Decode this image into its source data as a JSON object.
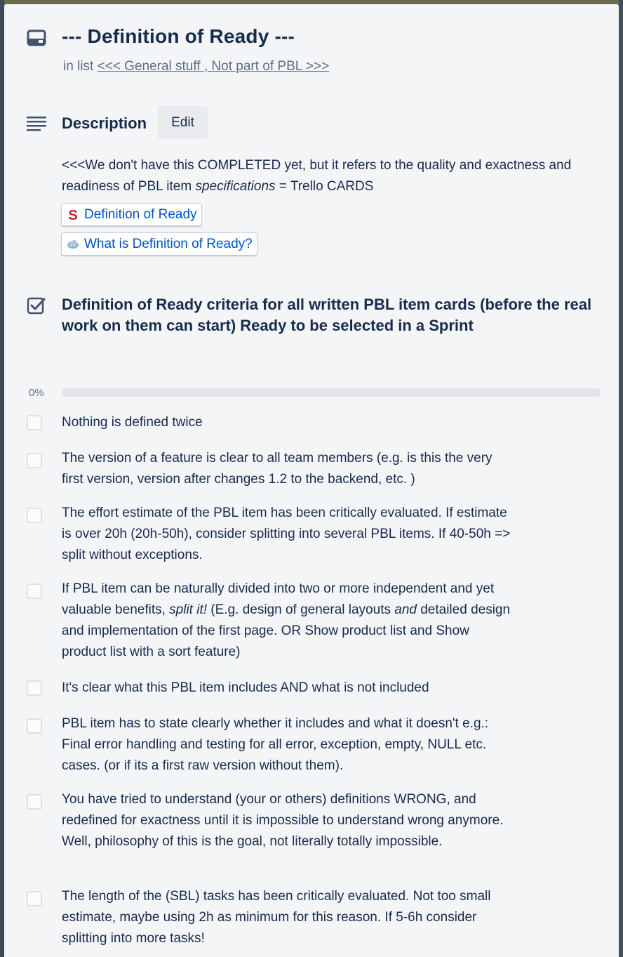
{
  "card": {
    "title": "--- Definition of Ready ---",
    "in_list_prefix": "in list",
    "list_name": "<<< General stuff , Not part of PBL >>>"
  },
  "description": {
    "heading": "Description",
    "edit_label": "Edit",
    "text_part1": "<<<We don't have this COMPLETED yet, but it refers to the quality and exactness and readiness of PBL item ",
    "text_italic": "specifications",
    "text_part2": " = Trello CARDS",
    "links": [
      {
        "label": "Definition of Ready",
        "icon": "scrum-s-icon"
      },
      {
        "label": "What is Definition of Ready?",
        "icon": "cloud-icon"
      }
    ]
  },
  "checklist": {
    "title": "Definition of Ready criteria for all written PBL item cards (before the real work on them can start) Ready to be selected in a Sprint",
    "progress_label": "0%",
    "progress_value": 0,
    "items": [
      {
        "text": "Nothing is defined twice",
        "checked": false
      },
      {
        "text": "The version of a feature is clear to all team members (e.g. is this the very first version, version after changes 1.2 to the backend, etc. )",
        "checked": false
      },
      {
        "text": "The effort estimate of the PBL item has been critically evaluated. If estimate is over 20h (20h-50h), consider splitting into several PBL items. If 40-50h => split without exceptions.",
        "checked": false
      },
      {
        "text_a": "If PBL item can be naturally divided into two or more independent and yet valuable benefits, ",
        "italic_a": "split it!",
        "text_b": " (E.g. design of general layouts ",
        "italic_b": "and",
        "text_c": " detailed design and implementation of the first page. OR Show product list and Show product list with a sort feature)",
        "checked": false
      },
      {
        "text": "It's clear what this PBL item includes AND what is not included",
        "checked": false
      },
      {
        "text": "PBL item has to state clearly whether it includes and what it doesn't e.g.: Final error handling and testing for all error, exception, empty, NULL etc. cases. (or if its a first raw version without them).",
        "checked": false
      },
      {
        "text": "You have tried to understand (your or others) definitions WRONG, and redefined for exactness until it is impossible to understand wrong anymore. Well, philosophy of this is the goal, not literally totally impossible.",
        "checked": false
      },
      {
        "text": "The length of the (SBL) tasks has been critically evaluated. Not too small estimate, maybe using 2h as minimum for this reason. If 5-6h consider splitting into more tasks!",
        "checked": false
      }
    ]
  },
  "colors": {
    "modal_bg": "#f4f5f7",
    "text": "#172b4d",
    "muted": "#5e6c84",
    "link": "#0052cc",
    "progress_track": "#e2e4e9"
  }
}
